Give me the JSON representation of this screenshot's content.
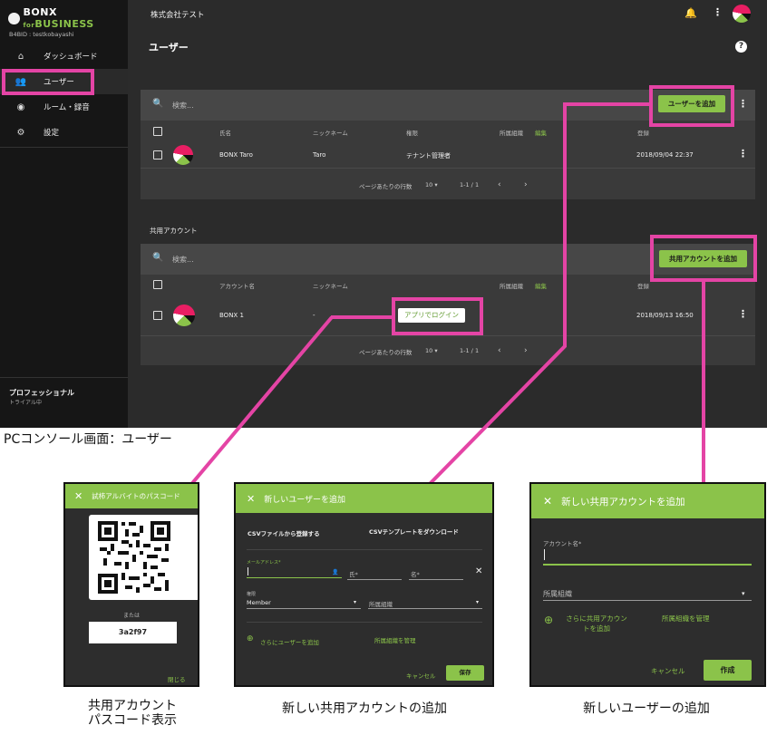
{
  "colors": {
    "accent": "#8bc34a",
    "highlight": "#e444a5",
    "sidebar": "#161616",
    "background": "#2b2b2b"
  },
  "sidebar": {
    "logo_main": "BONX",
    "logo_for": "for",
    "logo_business": "BUSINESS",
    "bid": "B4BID : testkobayashi",
    "items": [
      {
        "label": "ダッシュボード",
        "icon": "home-icon"
      },
      {
        "label": "ユーザー",
        "icon": "people-icon"
      },
      {
        "label": "ルーム・録音",
        "icon": "record-voice-icon"
      },
      {
        "label": "設定",
        "icon": "gear-icon"
      }
    ],
    "plan": "プロフェッショナル",
    "plan_status": "トライアル中"
  },
  "topbar": {
    "company": "株式会社テスト"
  },
  "page": {
    "title": "ユーザー"
  },
  "users_card": {
    "search_placeholder": "検索...",
    "add_button": "ユーザーを追加",
    "headers": {
      "name": "氏名",
      "nickname": "ニックネーム",
      "role": "権限",
      "org": "所属組織",
      "edit": "編集",
      "registered": "登録"
    },
    "rows": [
      {
        "name": "BONX Taro",
        "nickname": "Taro",
        "role": "テナント管理者",
        "registered": "2018/09/04 22:37"
      }
    ],
    "pager": {
      "rows_per_page": "ページあたりの行数",
      "per_page_value": "10",
      "range": "1-1 / 1"
    }
  },
  "shared_section": {
    "title": "共用アカウント",
    "search_placeholder": "検索...",
    "add_button": "共用アカウントを追加",
    "headers": {
      "account": "アカウント名",
      "nickname": "ニックネーム",
      "org": "所属組織",
      "edit": "編集",
      "registered": "登録"
    },
    "rows": [
      {
        "account": "BONX 1",
        "nickname": "-",
        "login_button": "アプリでログイン",
        "registered": "2018/09/13 16:50"
      }
    ],
    "pager": {
      "rows_per_page": "ページあたりの行数",
      "per_page_value": "10",
      "range": "1-1 / 1"
    }
  },
  "console_caption": "PCコンソール画面：ユーザー",
  "passcode_dialog": {
    "title": "試柿アルバイトのパスコード",
    "or_text": "または",
    "code": "3a2f97",
    "close": "閉じる"
  },
  "add_user_dialog": {
    "title": "新しいユーザーを追加",
    "csv_register": "CSVファイルから登録する",
    "csv_download": "CSVテンプレートをダウンロード",
    "email_label": "メールアドレス*",
    "last_name_label": "氏*",
    "first_name_label": "名*",
    "role_label": "権限",
    "role_value": "Member",
    "org_placeholder": "所属組織",
    "add_more": "さらにユーザーを追加",
    "manage_org": "所属組織を管理",
    "cancel": "キャンセル",
    "save": "保存"
  },
  "add_shared_dialog": {
    "title": "新しい共用アカウントを追加",
    "account_label": "アカウント名*",
    "org_placeholder": "所属組織",
    "add_more_line1": "さらに共用アカウン",
    "add_more_line2": "トを追加",
    "manage_org": "所属組織を管理",
    "cancel": "キャンセル",
    "create": "作成"
  },
  "captions": {
    "left_line1": "共用アカウント",
    "left_line2": "パスコード表示",
    "middle": "新しい共用アカウントの追加",
    "right": "新しいユーザーの追加"
  }
}
